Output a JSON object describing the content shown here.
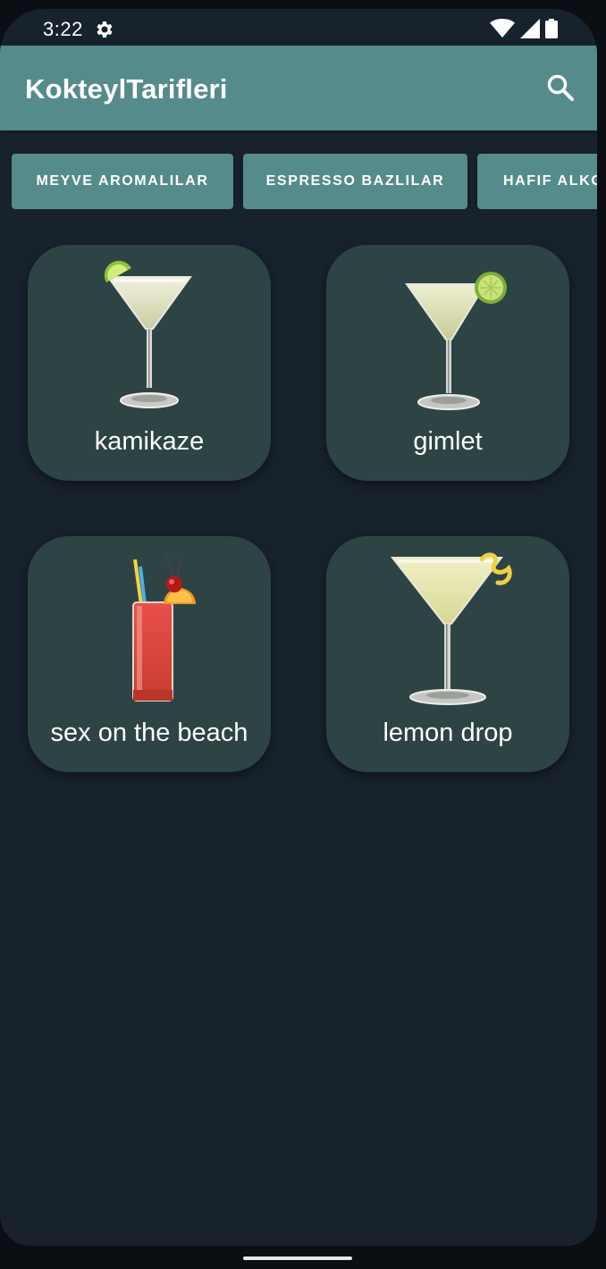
{
  "status_bar": {
    "time": "3:22",
    "icons": [
      "settings-gear-icon",
      "wifi-icon",
      "signal-icon",
      "battery-icon"
    ]
  },
  "app_bar": {
    "title": "KokteylTarifleri",
    "search_icon": "search-icon"
  },
  "categories": [
    {
      "label": "MEYVE AROMALILAR"
    },
    {
      "label": "ESPRESSO BAZLILAR"
    },
    {
      "label": "HAFIF ALKO"
    }
  ],
  "cocktails": [
    {
      "name": "kamikaze",
      "image": "martini-glass-lime-wedge"
    },
    {
      "name": "gimlet",
      "image": "martini-glass-lime-wheel"
    },
    {
      "name": "sex on the beach",
      "image": "highball-glass-orange-cherry"
    },
    {
      "name": "lemon drop",
      "image": "martini-glass-lemon-twist"
    }
  ],
  "colors": {
    "background": "#18222c",
    "app_bar": "#568b8b",
    "chip": "#568b8b",
    "card": "#2e4444",
    "text": "#ffffff"
  }
}
